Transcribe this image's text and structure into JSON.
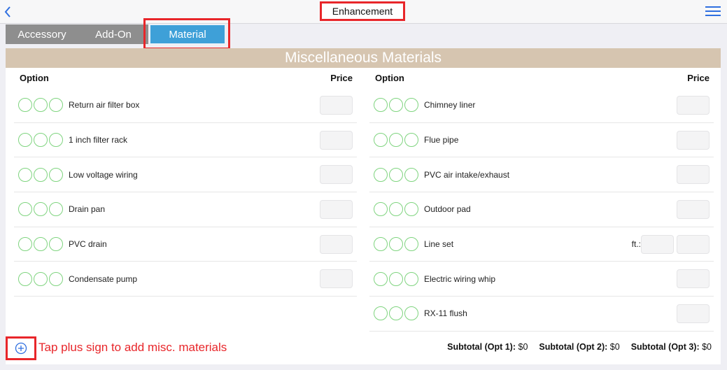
{
  "header": {
    "title": "Enhancement"
  },
  "tabs": [
    {
      "label": "Accessory",
      "active": false
    },
    {
      "label": "Add-On",
      "active": false
    },
    {
      "label": "Material",
      "active": true
    }
  ],
  "section": {
    "title": "Miscellaneous Materials"
  },
  "columns": {
    "option": "Option",
    "price": "Price"
  },
  "left_items": [
    {
      "label": "Return air filter box"
    },
    {
      "label": "1 inch filter rack"
    },
    {
      "label": "Low voltage wiring"
    },
    {
      "label": "Drain pan"
    },
    {
      "label": "PVC drain"
    },
    {
      "label": "Condensate pump"
    }
  ],
  "right_items": [
    {
      "label": "Chimney liner"
    },
    {
      "label": "Flue pipe"
    },
    {
      "label": "PVC air intake/exhaust"
    },
    {
      "label": "Outdoor pad"
    },
    {
      "label": "Line set",
      "extra_label": "ft.:"
    },
    {
      "label": "Electric wiring whip"
    },
    {
      "label": "RX-11 flush"
    }
  ],
  "footer": {
    "hint": "Tap plus sign to add misc. materials",
    "subtotals": [
      {
        "label": "Subtotal (Opt 1):",
        "value": "$0"
      },
      {
        "label": "Subtotal (Opt 2):",
        "value": "$0"
      },
      {
        "label": "Subtotal (Opt 3):",
        "value": "$0"
      }
    ]
  },
  "colors": {
    "accent_blue": "#3ea0d8",
    "banner": "#d6c5b0",
    "highlight_red": "#e8262a",
    "option_circle": "#7fd47f"
  },
  "icons": {
    "back": "chevron-left-icon",
    "menu": "hamburger-menu-icon",
    "add": "plus-circle-icon"
  }
}
